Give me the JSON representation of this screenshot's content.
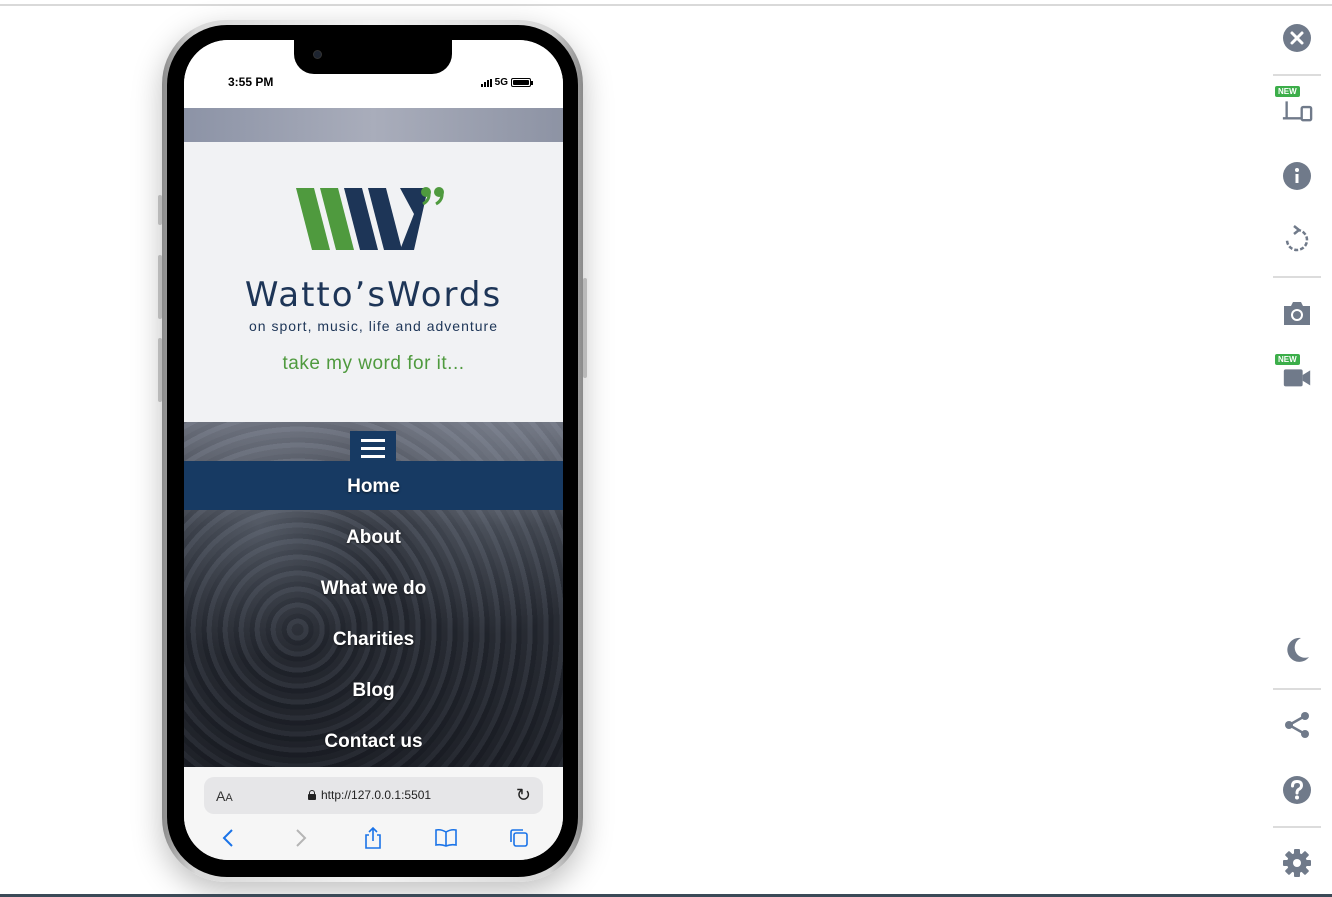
{
  "device": {
    "status_time": "3:55 PM",
    "network": "5G"
  },
  "site": {
    "brand": "Watto’sWords",
    "tagline": "on sport, music, life and adventure",
    "motto": "take my word for it...",
    "nav": [
      {
        "label": "Home",
        "active": true
      },
      {
        "label": "About",
        "active": false
      },
      {
        "label": "What we do",
        "active": false
      },
      {
        "label": "Charities",
        "active": false
      },
      {
        "label": "Blog",
        "active": false
      },
      {
        "label": "Contact us",
        "active": false
      }
    ],
    "colors": {
      "navy": "#173a63",
      "green": "#4f9a3e"
    }
  },
  "browser": {
    "aa": "A",
    "aa_small": "A",
    "url": "http://127.0.0.1:5501"
  },
  "sidebar": {
    "new_badge_1": "NEW",
    "new_badge_2": "NEW",
    "icons": [
      "close-icon",
      "device-icon",
      "info-icon",
      "rotate-icon",
      "camera-icon",
      "video-icon",
      "moon-icon",
      "share-icon",
      "help-icon",
      "gear-icon"
    ]
  }
}
